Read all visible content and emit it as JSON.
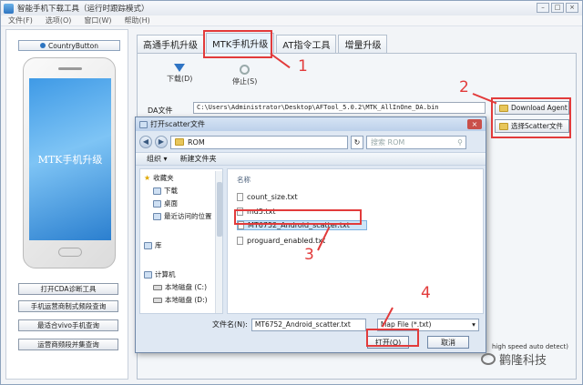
{
  "window": {
    "title": "智能手机下载工具（运行时跟踪模式）"
  },
  "menu": [
    "文件(F)",
    "选项(O)",
    "窗口(W)",
    "帮助(H)"
  ],
  "left_panel": {
    "country_button": "CountryButton",
    "phone_screen_text": "MTK手机升级",
    "buttons": [
      "打开CDA诊断工具",
      "手机运营商制式频段查询",
      "最适合vivo手机查询",
      "运营商频段并集查询"
    ]
  },
  "tabs": [
    {
      "label": "高通手机升级",
      "active": false
    },
    {
      "label": "MTK手机升级",
      "active": true
    },
    {
      "label": "AT指令工具",
      "active": false
    },
    {
      "label": "增量升级",
      "active": false
    }
  ],
  "toolbar": {
    "download": "下载(D)",
    "stop": "停止(S)"
  },
  "da": {
    "label": "DA文件",
    "path": "C:\\Users\\Administrator\\Desktop\\AFTool_5.0.2\\MTK_AllInOne_DA.bin",
    "download_agent_button": "Download Agent",
    "scatter_button": "选择Scatter文件"
  },
  "dialog": {
    "title": "打开scatter文件",
    "address": "ROM",
    "search_placeholder": "搜索 ROM",
    "organize": "组织 ▾",
    "new_folder": "新建文件夹",
    "nav": {
      "favorites": "收藏夹",
      "downloads": "下载",
      "desktop": "桌面",
      "recent": "最近访问的位置",
      "library": "库",
      "computer": "计算机",
      "disk_c": "本地磁盘 (C:)",
      "disk_d": "本地磁盘 (D:)"
    },
    "column_name": "名称",
    "files": [
      "count_size.txt",
      "md5.txt",
      "MT6752_Android_scatter.txt",
      "proguard_enabled.txt"
    ],
    "selected_file": "MT6752_Android_scatter.txt",
    "filename_label": "文件名(N):",
    "filename_value": "MT6752_Android_scatter.txt",
    "filter_value": "Map File (*.txt)",
    "open_button": "打开(O)",
    "cancel_button": "取消"
  },
  "annotations": [
    "1",
    "2",
    "3",
    "4"
  ],
  "status_text": "high speed auto detect)",
  "watermark": "鹳隆科技",
  "colors": {
    "highlight": "#e23b3b",
    "accent": "#2d74c0"
  }
}
